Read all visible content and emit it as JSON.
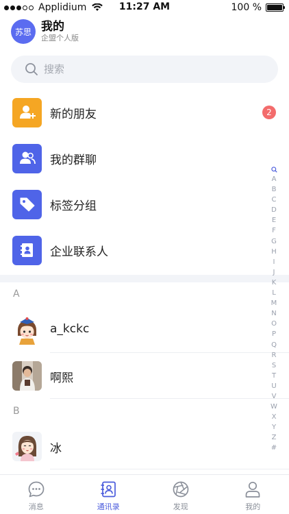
{
  "status_bar": {
    "carrier": "Applidium",
    "time": "11:27 AM",
    "battery": "100 %"
  },
  "header": {
    "avatar_text": "苏思",
    "title": "我的",
    "subtitle": "企盟个人版"
  },
  "search": {
    "placeholder": "搜索"
  },
  "functions": [
    {
      "label": "新的朋友",
      "icon": "add-user-icon",
      "color": "#f5a623",
      "badge": "2"
    },
    {
      "label": "我的群聊",
      "icon": "group-icon",
      "color": "#4f64e8"
    },
    {
      "label": "标签分组",
      "icon": "tag-icon",
      "color": "#4f64e8"
    },
    {
      "label": "企业联系人",
      "icon": "contact-book-icon",
      "color": "#4f64e8"
    }
  ],
  "sections": [
    {
      "letter": "A",
      "contacts": [
        {
          "name": "a_kckc"
        },
        {
          "name": "啊熙"
        }
      ]
    },
    {
      "letter": "B",
      "contacts": [
        {
          "name": "冰"
        }
      ]
    }
  ],
  "alpha_index": [
    "A",
    "B",
    "C",
    "D",
    "E",
    "F",
    "G",
    "H",
    "I",
    "J",
    "K",
    "L",
    "M",
    "N",
    "O",
    "P",
    "Q",
    "R",
    "S",
    "T",
    "U",
    "V",
    "W",
    "X",
    "Y",
    "Z",
    "#"
  ],
  "tabs": [
    {
      "label": "消息",
      "icon": "chat-bubble-icon",
      "active": false
    },
    {
      "label": "通讯录",
      "icon": "address-book-icon",
      "active": true
    },
    {
      "label": "发现",
      "icon": "aperture-icon",
      "active": false
    },
    {
      "label": "我的",
      "icon": "person-icon",
      "active": false
    }
  ],
  "colors": {
    "accent": "#4a5bdc",
    "badge": "#f36c6c",
    "orange": "#f5a623"
  }
}
